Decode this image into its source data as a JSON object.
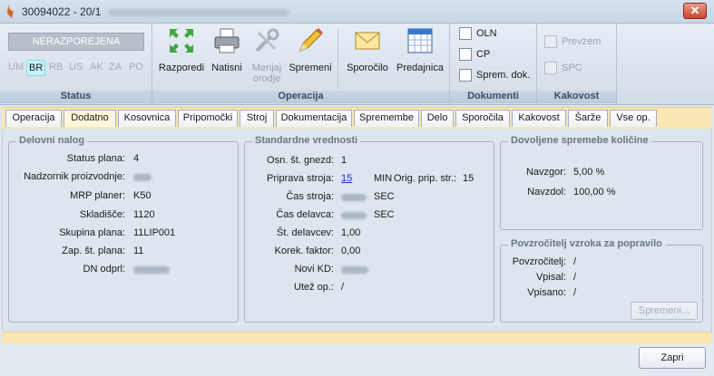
{
  "window": {
    "title": "30094022 - 20/1"
  },
  "ribbon": {
    "status_group": {
      "label": "Status",
      "status": "NERAZPOREJENA",
      "codes": [
        "UM",
        "BR",
        "RB",
        "US",
        "AK",
        "ZA",
        "PO"
      ],
      "active_code": "BR"
    },
    "operacija_group": {
      "label": "Operacija",
      "buttons": [
        {
          "label": "Razporedi",
          "icon": "arrows-icon",
          "enabled": true
        },
        {
          "label": "Natisni",
          "icon": "printer-icon",
          "enabled": true
        },
        {
          "label": "Menjaj orodje",
          "icon": "tools-icon",
          "enabled": false
        },
        {
          "label": "Spremeni",
          "icon": "pencil-icon",
          "enabled": true
        },
        {
          "label": "Sporočilo",
          "icon": "envelope-icon",
          "enabled": true
        },
        {
          "label": "Predajnica",
          "icon": "calendar-icon",
          "enabled": true
        }
      ]
    },
    "dokumenti_group": {
      "label": "Dokumenti",
      "items": [
        "OLN",
        "CP",
        "Sprem. dok."
      ]
    },
    "kakovost_group": {
      "label": "Kakovost",
      "items": [
        "Prevzem",
        "SPC"
      ]
    }
  },
  "tabs": [
    "Operacija",
    "Dodatno",
    "Kosovnica",
    "Pripomočki",
    "Stroj",
    "Dokumentacija",
    "Spremembe",
    "Delo",
    "Sporočila",
    "Kakovost",
    "Šarže",
    "Vse op."
  ],
  "active_tab": "Dodatno",
  "delovni_nalog": {
    "title": "Delovni nalog",
    "rows": [
      {
        "label": "Status plana:",
        "value": "4"
      },
      {
        "label": "Nadzornik proizvodnje:",
        "value": ""
      },
      {
        "label": "MRP planer:",
        "value": "K50"
      },
      {
        "label": "Skladišče:",
        "value": "1120"
      },
      {
        "label": "Skupina plana:",
        "value": "11LIP001"
      },
      {
        "label": "Zap. št. plana:",
        "value": "11"
      },
      {
        "label": "DN odprl:",
        "value": ""
      }
    ]
  },
  "standardne": {
    "title": "Standardne vrednosti",
    "rows": [
      {
        "label": "Osn. št. gnezd:",
        "value": "1"
      },
      {
        "label": "Priprava stroja:",
        "value": "15",
        "unit": "MIN",
        "extra_label": "Orig. prip. str.:",
        "extra_value": "15"
      },
      {
        "label": "Čas stroja:",
        "value": "",
        "unit": "SEC"
      },
      {
        "label": "Čas delavca:",
        "value": "",
        "unit": "SEC"
      },
      {
        "label": "Št. delavcev:",
        "value": "1,00"
      },
      {
        "label": "Korek. faktor:",
        "value": "0,00"
      },
      {
        "label": "Novi KD:",
        "value": ""
      },
      {
        "label": "Utež op.:",
        "value": "/"
      }
    ]
  },
  "dovoljene": {
    "title": "Dovoljene spremebe količine",
    "rows": [
      {
        "label": "Navzgor:",
        "value": "5,00 %"
      },
      {
        "label": "Navzdol:",
        "value": "100,00 %"
      }
    ]
  },
  "povzrocitelj": {
    "title": "Povzročitelj vzroka za popravilo",
    "rows": [
      {
        "label": "Povzročitelj:",
        "value": "/"
      },
      {
        "label": "Vpisal:",
        "value": "/"
      },
      {
        "label": "Vpisano:",
        "value": "/"
      }
    ],
    "button": "Spremeni..."
  },
  "footer": {
    "close_button": "Zapri"
  }
}
